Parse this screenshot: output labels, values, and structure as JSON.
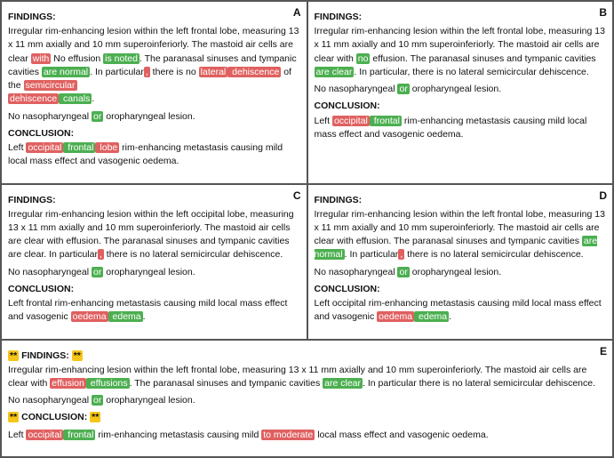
{
  "cells": {
    "A": {
      "label": "A",
      "findings_title": "FINDINGS:",
      "findings_text1": "Irregular rim-enhancing lesion within the left frontal lobe, measuring 13 x 11 mm axially and 10 mm superoinferiorly. The mastoid air cells are clear ",
      "with": "with",
      "no_effusion": " No effusion ",
      "is_noted": "is noted",
      "findings_text2": ". The paranasal sinuses and tympanic cavities ",
      "are_normal": "are normal",
      "findings_text3": ". In particular",
      "comma": ",",
      "findings_text4": " there is no ",
      "lateral": "lateral",
      "dehiscence": " dehiscence",
      "findings_text5": " of the ",
      "semicircular": "semicircular",
      "dehiscence2": "dehiscence",
      "canals": " canals",
      "findings_text6": ".",
      "nasopharyngeal": "No nasopharyngeal ",
      "or": "or",
      "oropharyngeal": " oropharyngeal lesion.",
      "conclusion_title": "CONCLUSION:",
      "conclusion_text1": "Left ",
      "occipital": "occipital",
      "frontal": " frontal",
      "lobe": " lobe",
      "conclusion_text2": " rim-enhancing metastasis causing mild local mass effect and vasogenic oedema."
    },
    "B": {
      "label": "B",
      "findings_title": "FINDINGS:",
      "findings_text1": "Irregular rim-enhancing lesion within the left frontal lobe, measuring 13 x 11 mm axially and 10 mm superoinferiorly. The mastoid air cells are clear with ",
      "no": "no",
      "findings_text2": " effusion. The paranasal sinuses and tympanic cavities ",
      "are_clear": "are clear",
      "findings_text3": ". In particular, there is no lateral semicircular dehiscence.",
      "nasopharyngeal": "No nasopharyngeal ",
      "or": "or",
      "oropharyngeal": " oropharyngeal lesion.",
      "conclusion_title": "CONCLUSION:",
      "conclusion_text1": "Left ",
      "occipital": "occipital",
      "frontal": " frontal",
      "conclusion_text2": " rim-enhancing metastasis causing mild local mass effect and vasogenic oedema."
    },
    "C": {
      "label": "C",
      "findings_title": "FINDINGS:",
      "findings_text1": "Irregular rim-enhancing lesion within the left occipital lobe, measuring 13 x 11 mm axially and 10 mm superoinferiorly. The mastoid air cells are clear with effusion. The paranasal sinuses and tympanic cavities are clear. In particular",
      "comma": ",",
      "findings_text2": " there is no lateral semicircular dehiscence.",
      "nasopharyngeal": "No nasopharyngeal ",
      "or": "or",
      "oropharyngeal": " oropharyngeal lesion.",
      "conclusion_title": "CONCLUSION:",
      "conclusion_text1": "Left frontal rim-enhancing metastasis causing mild local mass effect and vasogenic ",
      "oedema": "oedema",
      "edema": " edema",
      "period": "."
    },
    "D": {
      "label": "D",
      "findings_title": "FINDINGS:",
      "findings_text1": "Irregular rim-enhancing lesion within the left frontal lobe, measuring 13 x 11 mm axially and 10 mm superoinferiorly. The mastoid air cells are clear with effusion. The paranasal sinuses and tympanic cavities ",
      "are_normal": "are normal",
      "findings_text2": ". In particular",
      "comma": ",",
      "findings_text3": " there is no lateral semicircular dehiscence.",
      "nasopharyngeal": "No nasopharyngeal ",
      "or": "or",
      "oropharyngeal": " oropharyngeal lesion.",
      "conclusion_title": "CONCLUSION:",
      "conclusion_text1": "Left occipital rim-enhancing metastasis causing mild local mass effect and vasogenic ",
      "oedema": "oedema",
      "edema": " edema",
      "period": "."
    },
    "E": {
      "label": "E",
      "findings_title": "** FINDINGS: **",
      "findings_marker": "**",
      "findings_text1": "Irregular rim-enhancing lesion within the left frontal lobe, measuring 13 x 11 mm axially and 10 mm superoinferiorly. The mastoid air cells are clear with ",
      "effusion1": "effusion",
      "effusions": " effusions",
      "findings_text2": ". The paranasal sinuses and tympanic cavities ",
      "are_clear": "are clear",
      "findings_text3": ". In particular there is no lateral semicircular dehiscence.",
      "nasopharyngeal": "No nasopharyngeal ",
      "or": "or",
      "oropharyngeal": " oropharyngeal lesion.",
      "conclusion_title": "** CONCLUSION: **",
      "conclusion_text1": "Left ",
      "occipital": "occipital",
      "frontal": " frontal",
      "conclusion_text2": " rim-enhancing metastasis causing mild ",
      "to_moderate": "to moderate",
      "conclusion_text3": " local mass effect and vasogenic oedema."
    }
  }
}
